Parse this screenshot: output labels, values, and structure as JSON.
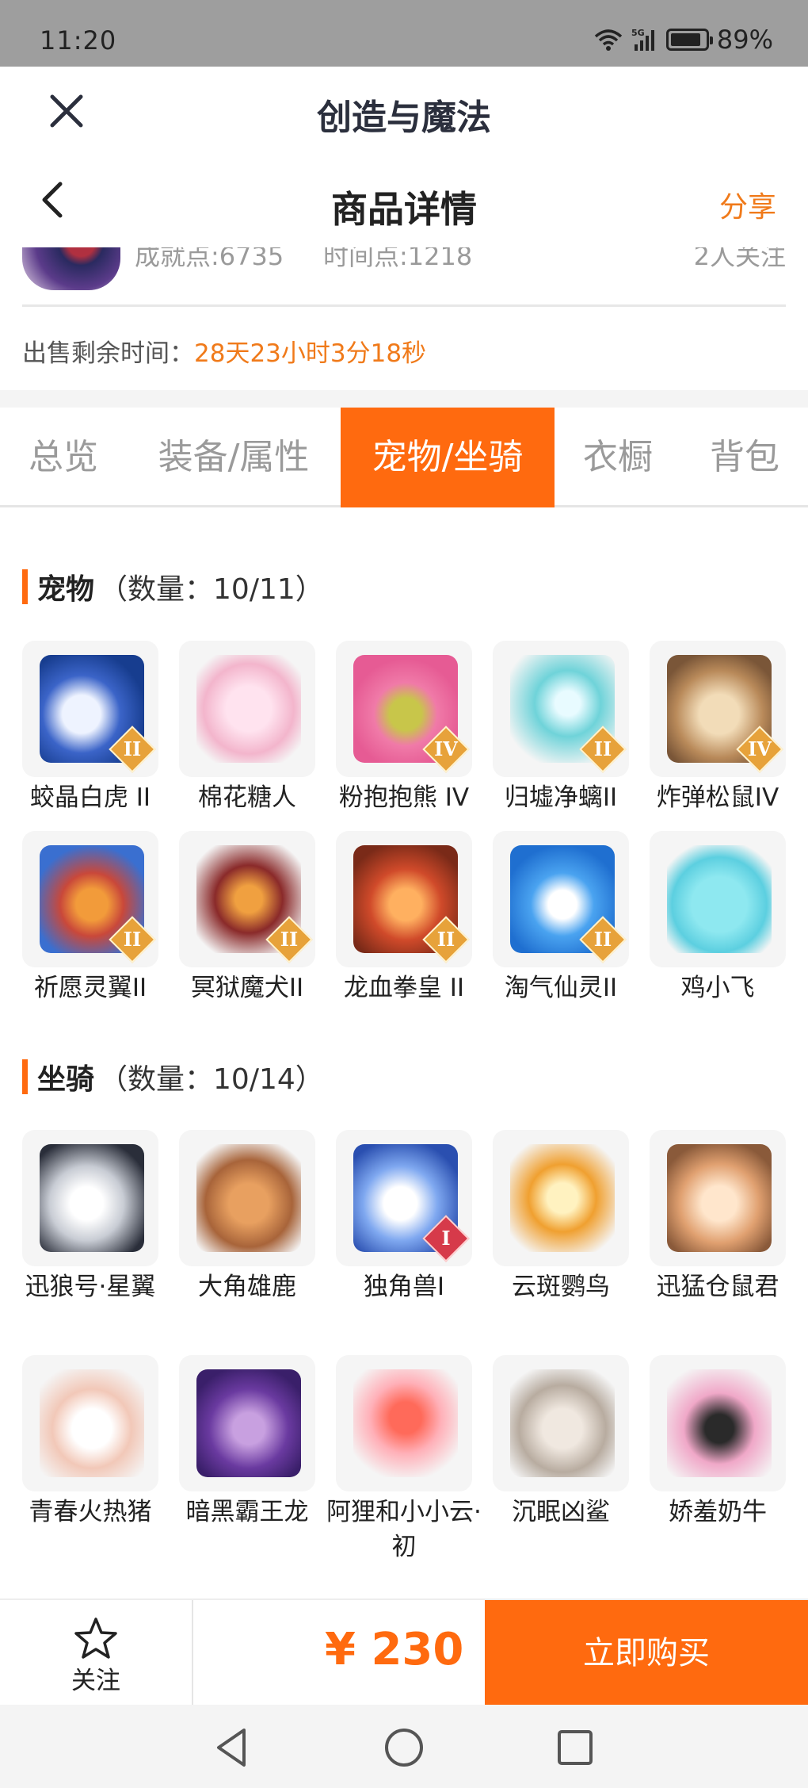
{
  "status_bar": {
    "time": "11:20",
    "battery": "89%",
    "battery_level": 0.89,
    "network": "5G"
  },
  "app_bar": {
    "title": "创造与魔法"
  },
  "header": {
    "title": "商品详情",
    "share_label": "分享"
  },
  "seller": {
    "achievement": "成就点:6735",
    "time_points": "时间点:1218",
    "followers": "2人关注"
  },
  "remaining": {
    "label": "出售剩余时间：",
    "value": "28天23小时3分18秒"
  },
  "tabs": [
    {
      "label": "总览",
      "active": false
    },
    {
      "label": "装备/属性",
      "active": false
    },
    {
      "label": "宠物/坐骑",
      "active": true
    },
    {
      "label": "衣橱",
      "active": false
    },
    {
      "label": "背包",
      "active": false
    }
  ],
  "pets": {
    "title": "宠物",
    "count": "（数量：10/11）",
    "items": [
      {
        "name": "蛟晶白虎 II",
        "badge": "II",
        "icon": "white-tiger-icon"
      },
      {
        "name": "棉花糖人",
        "badge": "",
        "icon": "cotton-candy-icon"
      },
      {
        "name": "粉抱抱熊 IV",
        "badge": "IV",
        "icon": "pink-bear-icon"
      },
      {
        "name": "归墟净螭II",
        "badge": "II",
        "icon": "water-dragon-icon"
      },
      {
        "name": "炸弹松鼠IV",
        "badge": "IV",
        "icon": "bomb-squirrel-icon"
      },
      {
        "name": "祈愿灵翼II",
        "badge": "II",
        "icon": "spirit-bird-icon"
      },
      {
        "name": "冥狱魔犬II",
        "badge": "II",
        "icon": "hell-hound-icon"
      },
      {
        "name": "龙血拳皇 II",
        "badge": "II",
        "icon": "dragon-boxer-icon"
      },
      {
        "name": "淘气仙灵II",
        "badge": "II",
        "icon": "naughty-fairy-icon"
      },
      {
        "name": "鸡小飞",
        "badge": "",
        "icon": "chick-icon"
      }
    ]
  },
  "mounts": {
    "title": "坐骑",
    "count": "（数量：10/14）",
    "items": [
      {
        "name": "迅狼号·星翼",
        "badge": "",
        "icon": "mech-wolf-icon"
      },
      {
        "name": "大角雄鹿",
        "badge": "",
        "icon": "stag-icon"
      },
      {
        "name": "独角兽I",
        "badge": "I",
        "icon": "unicorn-icon"
      },
      {
        "name": "云斑鹦鸟",
        "badge": "",
        "icon": "parrot-icon"
      },
      {
        "name": "迅猛仓鼠君",
        "badge": "",
        "icon": "hamster-icon"
      },
      {
        "name": "青春火热猪",
        "badge": "",
        "icon": "pig-icon"
      },
      {
        "name": "暗黑霸王龙",
        "badge": "",
        "icon": "trex-icon"
      },
      {
        "name": "阿狸和小小云·初",
        "badge": "",
        "icon": "fox-cloud-icon"
      },
      {
        "name": "沉眠凶鲨",
        "badge": "",
        "icon": "shark-icon"
      },
      {
        "name": "娇羞奶牛",
        "badge": "",
        "icon": "cow-icon"
      }
    ]
  },
  "action_bar": {
    "follow_label": "关注",
    "price": "¥ 230",
    "buy_label": "立即购买"
  },
  "colors": {
    "accent": "#ff6a0f",
    "highlight": "#f07a1a",
    "title": "#2b2f3d"
  }
}
